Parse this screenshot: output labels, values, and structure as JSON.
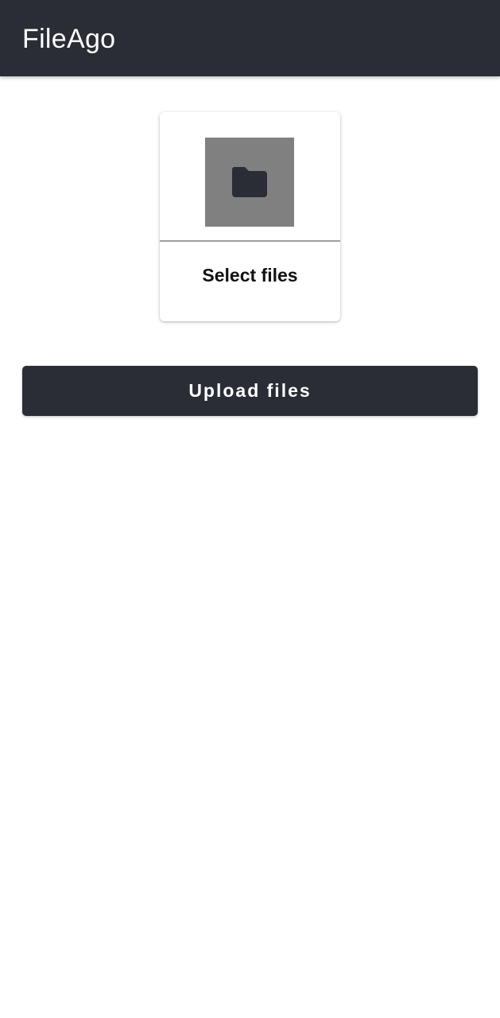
{
  "app_bar": {
    "title": "FileAgo"
  },
  "select_card": {
    "icon": "folder-icon",
    "label": "Select files"
  },
  "upload_button": {
    "label": "Upload files"
  },
  "colors": {
    "primary": "#2a2d36",
    "thumb_background": "#808080",
    "background": "#ffffff"
  }
}
